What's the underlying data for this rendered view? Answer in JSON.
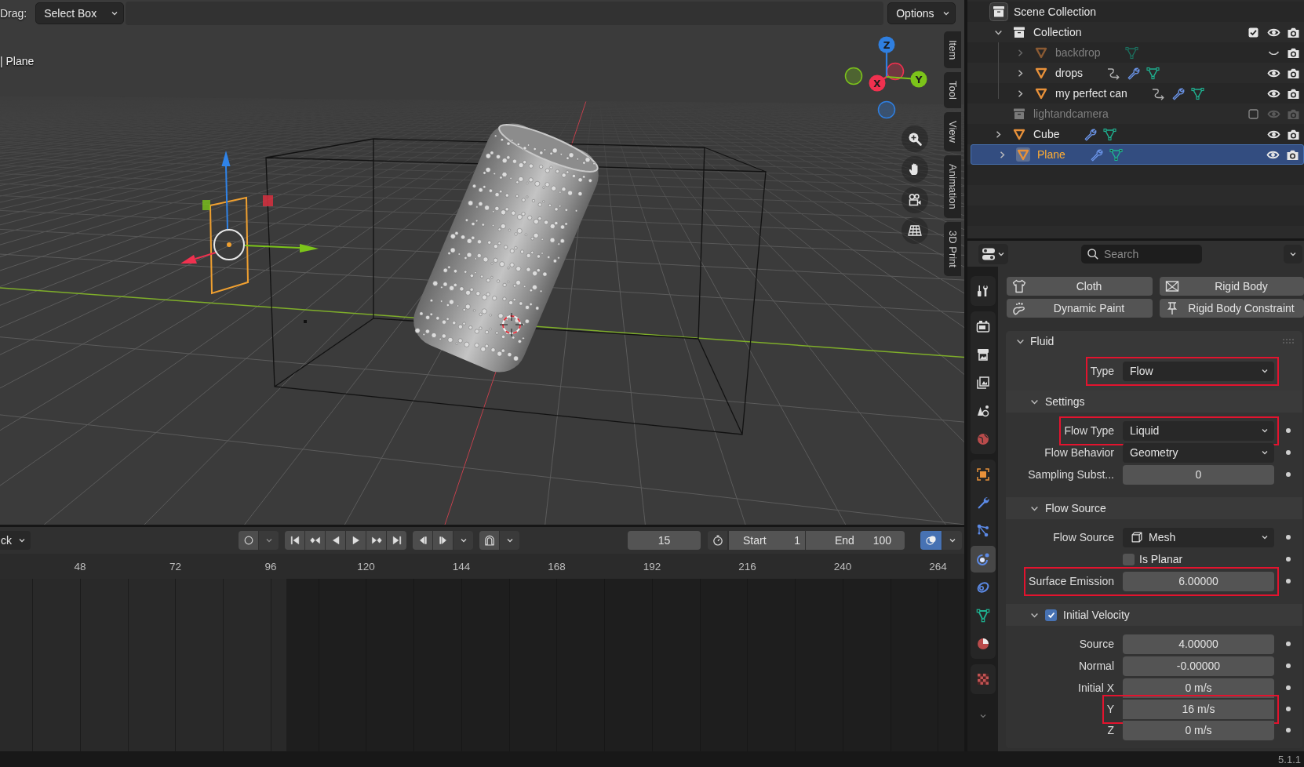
{
  "viewport": {
    "header": {
      "drag_label": "Drag:",
      "drag_mode": "Select Box",
      "options": "Options"
    },
    "object_label": "| Plane",
    "axes": [
      {
        "label": "Z",
        "color": "#2f7fe0"
      },
      {
        "label": "X",
        "color": "#f0314f"
      },
      {
        "label": "Y",
        "color": "#7cc41a"
      }
    ],
    "side_tabs": [
      {
        "label": "Item",
        "selected": false
      },
      {
        "label": "Tool",
        "selected": false
      },
      {
        "label": "View",
        "selected": false
      },
      {
        "label": "Animation",
        "selected": false
      },
      {
        "label": "3D Print",
        "selected": false
      }
    ]
  },
  "timeline": {
    "mode": "ck",
    "auto_keying": {
      "on": false
    },
    "current_frame": "15",
    "start_label": "Start",
    "start": "1",
    "end_label": "End",
    "end": "100",
    "overlays": {
      "on": true
    },
    "ruler": [
      "48",
      "72",
      "96",
      "120",
      "144",
      "168",
      "192",
      "216",
      "240",
      "264"
    ]
  },
  "outliner": {
    "root": {
      "name": "Scene Collection",
      "children": [
        {
          "name": "Collection",
          "kind": "collection",
          "expanded": true,
          "checked": true,
          "visible": true,
          "selected": false,
          "children": [
            {
              "name": "backdrop",
              "kind": "mesh",
              "expanded": false,
              "visible": false,
              "selected": false,
              "constraint": false,
              "modifier": false
            },
            {
              "name": "drops",
              "kind": "mesh",
              "expanded": false,
              "visible": true,
              "selected": false,
              "constraint": true,
              "modifier": true
            },
            {
              "name": "my perfect can",
              "kind": "mesh",
              "expanded": false,
              "visible": true,
              "selected": false,
              "constraint": true,
              "modifier": true
            }
          ]
        },
        {
          "name": "lightandcamera",
          "kind": "collection",
          "checked": false,
          "visible": true,
          "selected": false
        },
        {
          "name": "Cube",
          "kind": "mesh",
          "expanded": false,
          "visible": true,
          "selected": false,
          "constraint": false,
          "modifier": true
        },
        {
          "name": "Plane",
          "kind": "mesh",
          "expanded": false,
          "visible": true,
          "selected": true,
          "constraint": false,
          "modifier": true
        }
      ]
    }
  },
  "properties": {
    "search": {
      "placeholder": "Search"
    },
    "tab_groups": [
      [
        {
          "kind": "tool",
          "selected": false
        }
      ],
      [
        {
          "kind": "render",
          "selected": false
        },
        {
          "kind": "output",
          "selected": false
        },
        {
          "kind": "view-layer",
          "selected": false
        },
        {
          "kind": "scene",
          "selected": false
        },
        {
          "kind": "world",
          "selected": false
        }
      ],
      [
        {
          "kind": "object",
          "selected": false
        },
        {
          "kind": "modifiers",
          "selected": false
        },
        {
          "kind": "particles",
          "selected": false
        },
        {
          "kind": "physics",
          "selected": true
        },
        {
          "kind": "constraints",
          "selected": false
        },
        {
          "kind": "data",
          "selected": false
        },
        {
          "kind": "material",
          "selected": false
        }
      ],
      [
        {
          "kind": "texture",
          "selected": false
        }
      ]
    ],
    "physics_buttons": [
      {
        "kind": "cloth",
        "label": "Cloth"
      },
      {
        "kind": "rigid-body",
        "label": "Rigid Body"
      },
      {
        "kind": "dynamic-paint",
        "label": "Dynamic Paint"
      },
      {
        "kind": "rigid-body-constraint",
        "label": "Rigid Body Constraint"
      }
    ],
    "panel": {
      "title": "Fluid",
      "expanded": true,
      "rows": [
        {
          "kind": "enum",
          "label": "Type",
          "value": "Flow",
          "highlighted": true,
          "decorator": false
        }
      ],
      "subpanels": [
        {
          "title": "Settings",
          "expanded": true,
          "rows": [
            {
              "kind": "enum",
              "label": "Flow Type",
              "value": "Liquid",
              "highlighted": true,
              "decorator": true
            },
            {
              "kind": "enum",
              "label": "Flow Behavior",
              "value": "Geometry",
              "highlighted": false,
              "decorator": true
            },
            {
              "kind": "number",
              "label": "Sampling Subst...",
              "value": "0",
              "highlighted": false,
              "decorator": true
            }
          ]
        },
        {
          "title": "Flow Source",
          "expanded": true,
          "rows": [
            {
              "kind": "enum-icon",
              "label": "Flow Source",
              "value": "Mesh",
              "highlighted": false,
              "decorator": true
            },
            {
              "kind": "checkbox",
              "label": "Is Planar",
              "checked": false,
              "highlighted": false,
              "decorator": true
            },
            {
              "kind": "number",
              "label": "Surface Emission",
              "value": "6.00000",
              "highlighted": true,
              "decorator": true
            }
          ]
        },
        {
          "title": "Initial Velocity",
          "expanded": true,
          "checked": true,
          "rows": [
            {
              "kind": "number",
              "label": "Source",
              "value": "4.00000",
              "highlighted": false,
              "decorator": true,
              "joined": false
            },
            {
              "kind": "number",
              "label": "Normal",
              "value": "-0.00000",
              "highlighted": false,
              "decorator": true,
              "joined": false
            },
            {
              "kind": "number",
              "label": "Initial X",
              "value": "0 m/s",
              "highlighted": false,
              "decorator": true,
              "joined": false
            },
            {
              "kind": "number",
              "label": "Y",
              "value": "16 m/s",
              "highlighted": true,
              "decorator": true,
              "joined": true
            },
            {
              "kind": "number",
              "label": "Z",
              "value": "0 m/s",
              "highlighted": false,
              "decorator": true,
              "joined": true
            }
          ]
        }
      ]
    }
  },
  "status_bar": {
    "version": "5.1.1"
  }
}
